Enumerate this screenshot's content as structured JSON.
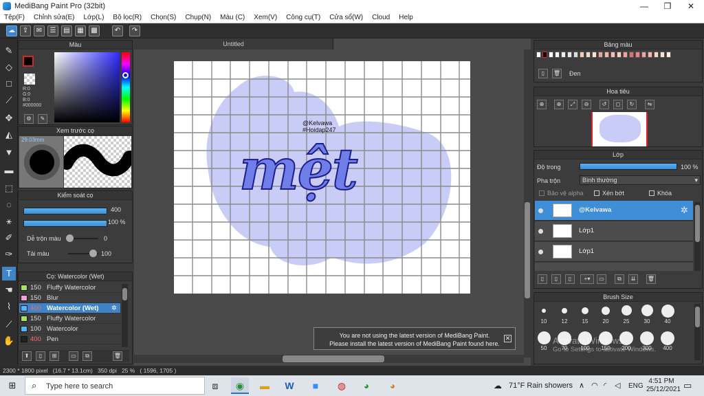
{
  "window": {
    "title": "MediBang Paint Pro (32bit)",
    "min": "—",
    "max": "❐",
    "close": "✕"
  },
  "menu": [
    "Tệp(F)",
    "Chỉnh sửa(E)",
    "Lớp(L)",
    "Bộ lọc(R)",
    "Chọn(S)",
    "Chụp(N)",
    "Màu (C)",
    "Xem(V)",
    "Công cụ(T)",
    "Cửa sổ(W)",
    "Cloud",
    "Help"
  ],
  "panels": {
    "color": {
      "title": "Màu",
      "r": "R:0",
      "g": "G:0",
      "b": "B:0",
      "hex": "#000000"
    },
    "brush_preview": {
      "title": "Xem trước cọ",
      "size": "29.03mm"
    },
    "brush_control": {
      "title": "Kiểm soát cọ",
      "size_value": "400",
      "opacity_value": "100 %",
      "blend_label": "Dễ trộn màu",
      "blend_value": "0",
      "reload_label": "Tải màu",
      "reload_value": "100"
    },
    "brush_list": {
      "title": "Cọ: Watercolor (Wet)",
      "items": [
        {
          "size": "150",
          "name": "Fluffy Watercolor",
          "color": "#a8e060"
        },
        {
          "size": "150",
          "name": "Blur",
          "color": "#f0a0d8"
        },
        {
          "size": "400",
          "name": "Watercolor (Wet)",
          "color": "#4fb8f0"
        },
        {
          "size": "150",
          "name": "Fluffy Watercolor",
          "color": "#a8e060"
        },
        {
          "size": "100",
          "name": "Watercolor",
          "color": "#4fb8f0"
        },
        {
          "size": "400",
          "name": "Pen",
          "color": "#222222"
        }
      ]
    },
    "palette": {
      "title": "Bảng màu",
      "color_name": "Đen"
    },
    "navigator": {
      "title": "Hoa tiêu"
    },
    "layer": {
      "title": "Lớp",
      "opacity_label": "Độ trong",
      "opacity_value": "100 %",
      "blend_label": "Pha trộn",
      "blend_value": "Bình thường",
      "protect_alpha": "Bảo vệ alpha",
      "clipping": "Xén bớt",
      "lock": "Khóa",
      "layers": [
        {
          "name": "@Kelvawa"
        },
        {
          "name": "Lớp1"
        },
        {
          "name": "Lớp1"
        }
      ]
    },
    "brush_size": {
      "title": "Brush Size",
      "sizes": [
        "10",
        "12",
        "15",
        "20",
        "25",
        "30",
        "40",
        "50",
        "70",
        "100",
        "150",
        "200",
        "300",
        "400"
      ]
    }
  },
  "document": {
    "tab": "Untitled",
    "watermark_line1": "@Kelvawa",
    "watermark_line2": "#Hoidap247",
    "art_text": "mệt"
  },
  "notification": {
    "line1": "You are not using the latest version of MediBang Paint.",
    "line2": "Please install the latest version of MediBang Paint found here."
  },
  "status": {
    "text": "2300 * 1800 pixel   (16.7 * 13.1cm)   350 dpi   25 %   ( 1596, 1705 )"
  },
  "overlay": {
    "line1": "Activate Windows",
    "line2": "Go to Settings to activate Windows."
  },
  "taskbar": {
    "search_placeholder": "Type here to search",
    "weather": "71°F  Rain showers",
    "lang": "ENG",
    "time": "4:51 PM",
    "date": "25/12/2021"
  },
  "colors": {
    "accent": "#3f83c9",
    "blob": "#c8ccf6",
    "lettering": "#6f7ee8"
  }
}
